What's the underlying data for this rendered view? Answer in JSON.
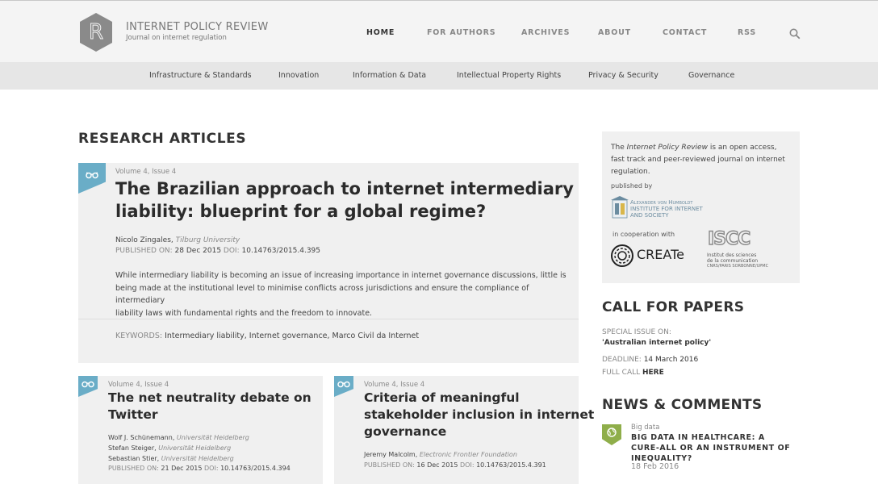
{
  "header": {
    "site_title": "INTERNET POLICY REVIEW",
    "site_subtitle": "Journal on internet regulation",
    "logo_letter": "R",
    "nav": [
      {
        "label": "HOME"
      },
      {
        "label": "FOR AUTHORS"
      },
      {
        "label": "ARCHIVES"
      },
      {
        "label": "ABOUT"
      },
      {
        "label": "CONTACT"
      },
      {
        "label": "RSS"
      }
    ],
    "search_icon": "search-icon",
    "active_nav": "HOME"
  },
  "categories": [
    "Infrastructure & Standards",
    "Innovation",
    "Information & Data",
    "Intellectual Property Rights",
    "Privacy & Security",
    "Governance"
  ],
  "main": {
    "section_title": "RESEARCH ARTICLES",
    "featured": {
      "volume": "Volume 4, Issue 4",
      "title_line1": "The Brazilian approach to internet intermediary",
      "title_line2": "liability: blueprint for a global regime?",
      "author": "Nicolo Zingales",
      "institution": "Tilburg University",
      "published_label": "PUBLISHED ON:",
      "published_date": "28 Dec 2015",
      "doi_label": "DOI:",
      "doi": "10.14763/2015.4.395",
      "abstract_lines": [
        "While intermediary liability is becoming an issue of increasing importance in internet governance discussions, little is",
        "being made at the institutional level to minimise conflicts across jurisdictions and ensure the compliance of intermediary",
        "liability laws with fundamental rights and the freedom to innovate."
      ],
      "keywords_label": "KEYWORDS:",
      "keywords": "Intermediary liability, Internet governance, Marco Civil da Internet"
    },
    "articles": [
      {
        "volume": "Volume 4, Issue 4",
        "title_line1": "The net neutrality debate on",
        "title_line2": "Twitter",
        "authors": [
          {
            "name": "Wolf J. Schünemann",
            "institution": "Universität Heidelberg"
          },
          {
            "name": "Stefan Steiger",
            "institution": "Universität Heidelberg"
          },
          {
            "name": "Sebastian Stier",
            "institution": "Universität Heidelberg"
          }
        ],
        "published_label": "PUBLISHED ON:",
        "published_date": "21 Dec 2015",
        "doi_label": "DOI:",
        "doi": "10.14763/2015.4.394"
      },
      {
        "volume": "Volume 4, Issue 4",
        "title_line1": "Criteria of meaningful",
        "title_line2": "stakeholder inclusion in internet",
        "title_line3": "governance",
        "authors": [
          {
            "name": "Jeremy Malcolm",
            "institution": "Electronic Frontier Foundation"
          }
        ],
        "published_label": "PUBLISHED ON:",
        "published_date": "16 Dec 2015",
        "doi_label": "DOI:",
        "doi": "10.14763/2015.4.391"
      }
    ]
  },
  "sidebar": {
    "about_prefix": "The ",
    "about_journal": "Internet Policy Review",
    "about_rest": " is an open access, fast track and peer-reviewed journal on internet regulation.",
    "published_by": "published by",
    "hiig_line1": "Alexander von Humboldt",
    "hiig_line2": "INSTITUTE FOR INTERNET",
    "hiig_line3": "AND SOCIETY",
    "cooperation": "in cooperation with",
    "create_name": "CREATe",
    "iscc_name": "ISCC",
    "iscc_line1": "Institut des sciences",
    "iscc_line2": "de la communication",
    "iscc_line3": "CNRS/PARIS SORBONNE/UPMC",
    "call_title": "CALL FOR PAPERS",
    "special_issue_label": "SPECIAL ISSUE ON:",
    "special_issue": "'Australian internet policy'",
    "deadline_label": "DEADLINE:",
    "deadline": "14 March 2016",
    "full_call_label": "FULL CALL",
    "full_call_link": "HERE",
    "news_title": "NEWS & COMMENTS",
    "news_item": {
      "category": "Big data",
      "title": "BIG DATA IN HEALTHCARE: A CURE-ALL OR AN INSTRUMENT OF INEQUALITY?",
      "date": "18 Feb 2016",
      "icon": "globe-icon"
    }
  },
  "colors": {
    "ribbon": "#6aadc7",
    "news_icon": "#8fae4a",
    "header_bg": "#f4f4f4",
    "catbar_bg": "#e6e6e6",
    "card_bg": "#f0f0f0"
  }
}
